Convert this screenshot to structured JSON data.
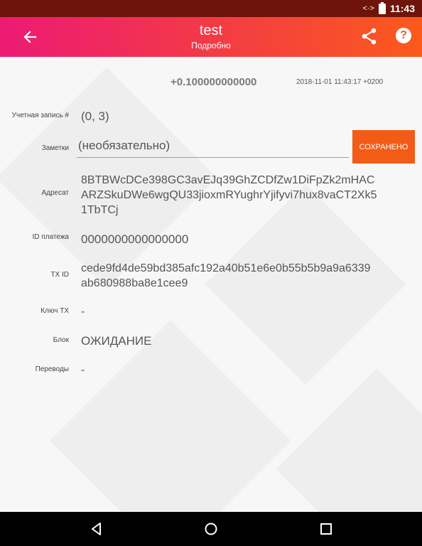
{
  "status_bar": {
    "time": "11:43",
    "data_indicator": "<·>"
  },
  "toolbar": {
    "title": "test",
    "subtitle": "Подробно",
    "help_symbol": "?"
  },
  "transaction": {
    "amount": "+0.100000000000",
    "datetime": "2018-11-01 11:43:17 +0200"
  },
  "fields": {
    "account_label": "Учетная запись #",
    "account_value": "(0, 3)",
    "notes_label": "Заметки",
    "notes_placeholder": "(необязательно)",
    "save_label": "СОХРАНЕНО",
    "address_label": "Адресат",
    "address_line1": "8BTBWcDCe398GC3avEJq39GhZCDfZw1DiFpZk2mHAC",
    "address_line2": "ARZSkuDWe6wgQU33jioxmRYughrYjifyvi7hux8vaCT2Xk5",
    "address_line3": "1TbTCj",
    "payment_id_label": "ID платежа",
    "payment_id_value": "0000000000000000",
    "txid_label": "TX ID",
    "txid_line1": "cede9fd4de59bd385afc192a40b51e6e0b55b5b9a9a6339",
    "txid_line2": "ab680988ba8e1cee9",
    "txkey_label": "Ключ TX",
    "txkey_value": "-",
    "block_label": "Блок",
    "block_value": "ОЖИДАНИЕ",
    "transfers_label": "Переводы",
    "transfers_value": "-"
  },
  "colors": {
    "toolbar_start": "#ec1a75",
    "toolbar_end": "#fb5a1c",
    "accent": "#f25c16",
    "status_bar": "#6e140a"
  }
}
